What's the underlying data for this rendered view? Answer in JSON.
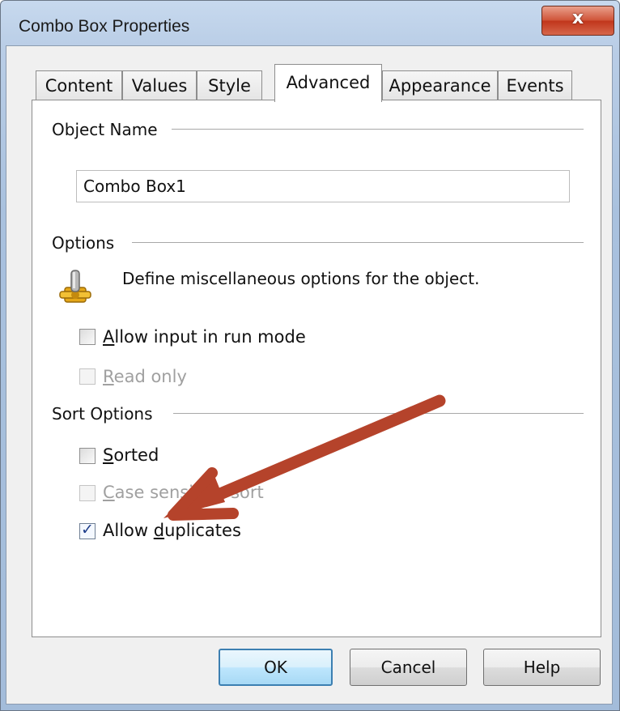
{
  "window": {
    "title": "Combo Box Properties",
    "close_label": "x"
  },
  "tabs": [
    {
      "label": "Content"
    },
    {
      "label": "Values"
    },
    {
      "label": "Style"
    },
    {
      "label": "Advanced"
    },
    {
      "label": "Appearance"
    },
    {
      "label": "Events"
    }
  ],
  "active_tab": "Advanced",
  "object_name": {
    "group_label": "Object Name",
    "value": "Combo Box1"
  },
  "options": {
    "group_label": "Options",
    "description": "Define miscellaneous options for the object.",
    "icon": "gear-icon",
    "allow_input": {
      "label_prefix": "",
      "mnemonic": "A",
      "label_rest": "llow input in run mode",
      "checked": false,
      "enabled": true
    },
    "read_only": {
      "label_prefix": "",
      "mnemonic": "R",
      "label_rest": "ead only",
      "checked": false,
      "enabled": false
    }
  },
  "sort_options": {
    "group_label": "Sort Options",
    "sorted": {
      "label_prefix": "",
      "mnemonic": "S",
      "label_rest": "orted",
      "checked": false,
      "enabled": true
    },
    "case_sensitive": {
      "label_prefix": "",
      "mnemonic": "C",
      "label_rest": "ase sensitive sort",
      "checked": false,
      "enabled": false
    },
    "allow_duplicates": {
      "label_prefix": "Allow ",
      "mnemonic": "d",
      "label_rest": "uplicates",
      "checked": true,
      "enabled": true
    }
  },
  "buttons": {
    "ok": "OK",
    "cancel": "Cancel",
    "help": "Help"
  },
  "colors": {
    "annotation_arrow": "#b5432b",
    "default_button_border": "#3c7fb1",
    "close_button": "#c1361c"
  }
}
